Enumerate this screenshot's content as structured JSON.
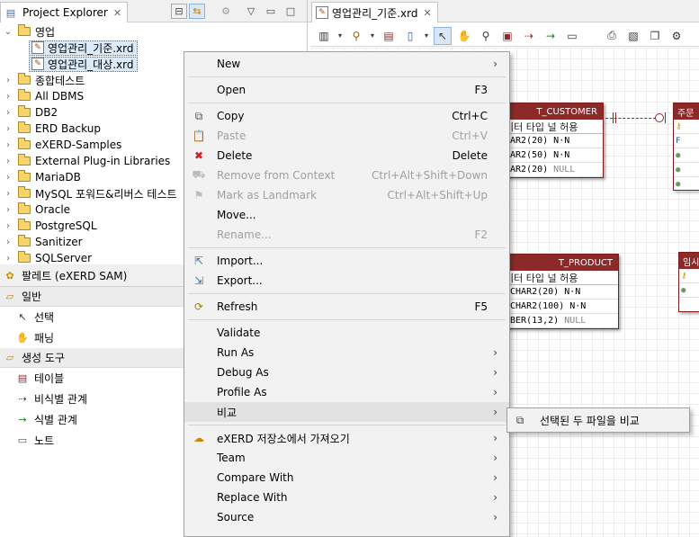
{
  "explorer": {
    "tab_title": "Project Explorer",
    "tree": [
      {
        "label": "영업",
        "expanded": true,
        "indent": 0
      },
      {
        "label": "영업관리_기준.xrd",
        "file": true,
        "indent": 1,
        "selected": true
      },
      {
        "label": "영업관리_대상.xrd",
        "file": true,
        "indent": 1,
        "selected": true
      },
      {
        "label": "종합테스트",
        "indent": 0
      },
      {
        "label": "All DBMS",
        "indent": 0
      },
      {
        "label": "DB2",
        "indent": 0
      },
      {
        "label": "ERD Backup",
        "indent": 0
      },
      {
        "label": "eXERD-Samples",
        "indent": 0
      },
      {
        "label": "External Plug-in Libraries",
        "indent": 0
      },
      {
        "label": "MariaDB",
        "indent": 0
      },
      {
        "label": "MySQL 포워드&리버스 테스트",
        "indent": 0
      },
      {
        "label": "Oracle",
        "indent": 0
      },
      {
        "label": "PostgreSQL",
        "indent": 0
      },
      {
        "label": "Sanitizer",
        "indent": 0
      },
      {
        "label": "SQLServer",
        "indent": 0
      }
    ]
  },
  "palette": {
    "tab_title": "팔레트 (eXERD SAM)",
    "groups": [
      {
        "label": "일반",
        "items": [
          {
            "label": "선택",
            "icon": "arrow"
          },
          {
            "label": "패닝",
            "icon": "hand"
          }
        ]
      },
      {
        "label": "생성 도구",
        "items": [
          {
            "label": "테이블",
            "icon": "table"
          },
          {
            "label": "비식별 관계",
            "icon": "dash"
          },
          {
            "label": "식별 관계",
            "icon": "line"
          },
          {
            "label": "노트",
            "icon": "note"
          }
        ]
      }
    ]
  },
  "editor": {
    "tab_title": "영업관리_기준.xrd",
    "entities": [
      {
        "title": "T_CUSTOMER",
        "header": "이터 타입  널 허용",
        "rows": [
          [
            "HAR2(20)",
            "N·N"
          ],
          [
            "HAR2(50)",
            "N·N"
          ],
          [
            "HAR2(20)",
            "NULL"
          ]
        ]
      },
      {
        "title": "T_PRODUCT",
        "header": "이터 타입  널 허용",
        "rows": [
          [
            "RCHAR2(20)",
            "N·N"
          ],
          [
            "RCHAR2(100)",
            "N·N"
          ],
          [
            "MBER(13,2)",
            "NULL"
          ]
        ]
      },
      {
        "title": "주문",
        "header": "",
        "rows": []
      },
      {
        "title": "임시",
        "header": "",
        "rows": []
      }
    ]
  },
  "context_menu": {
    "items": [
      {
        "label": "New",
        "submenu": true
      },
      {
        "sep": true
      },
      {
        "label": "Open",
        "accel": "F3"
      },
      {
        "sep": true
      },
      {
        "label": "Copy",
        "accel": "Ctrl+C",
        "icon": "copy"
      },
      {
        "label": "Paste",
        "accel": "Ctrl+V",
        "icon": "paste",
        "disabled": true
      },
      {
        "label": "Delete",
        "accel": "Delete",
        "icon": "delete"
      },
      {
        "label": "Remove from Context",
        "accel": "Ctrl+Alt+Shift+Down",
        "icon": "remove",
        "disabled": true
      },
      {
        "label": "Mark as Landmark",
        "accel": "Ctrl+Alt+Shift+Up",
        "icon": "landmark",
        "disabled": true
      },
      {
        "label": "Move..."
      },
      {
        "label": "Rename...",
        "accel": "F2",
        "disabled": true
      },
      {
        "sep": true
      },
      {
        "label": "Import...",
        "icon": "import"
      },
      {
        "label": "Export...",
        "icon": "export"
      },
      {
        "sep": true
      },
      {
        "label": "Refresh",
        "accel": "F5",
        "icon": "refresh"
      },
      {
        "sep": true
      },
      {
        "label": "Validate"
      },
      {
        "label": "Run As",
        "submenu": true
      },
      {
        "label": "Debug As",
        "submenu": true
      },
      {
        "label": "Profile As",
        "submenu": true
      },
      {
        "label": "비교",
        "submenu": true,
        "highlighted": true
      },
      {
        "sep": true
      },
      {
        "label": "eXERD 저장소에서 가져오기",
        "submenu": true,
        "icon": "exerd"
      },
      {
        "label": "Team",
        "submenu": true
      },
      {
        "label": "Compare With",
        "submenu": true
      },
      {
        "label": "Replace With",
        "submenu": true
      },
      {
        "label": "Source",
        "submenu": true
      }
    ]
  },
  "submenu": {
    "label": "선택된 두 파일을 비교"
  }
}
